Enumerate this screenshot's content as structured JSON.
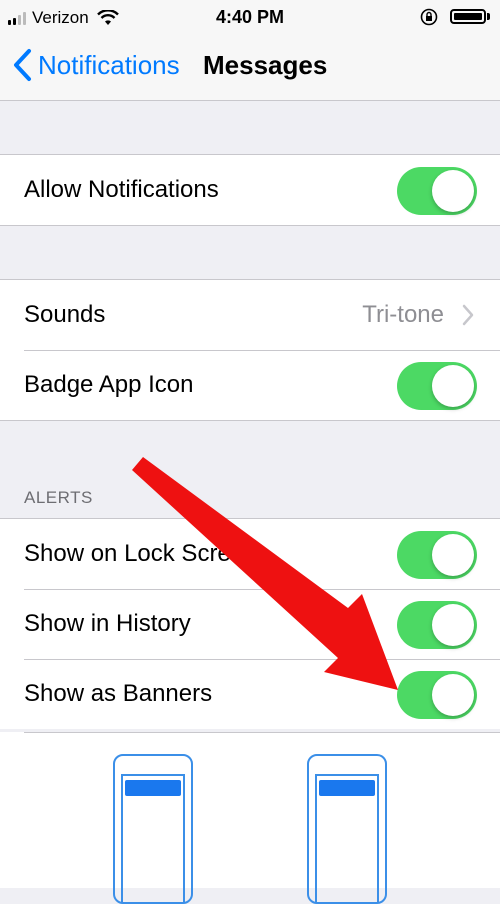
{
  "status_bar": {
    "carrier": "Verizon",
    "time": "4:40 PM",
    "battery_level": 1.0
  },
  "nav": {
    "back_label": "Notifications",
    "title": "Messages"
  },
  "groups": {
    "allow": {
      "label": "Allow Notifications",
      "on": true
    },
    "sounds": {
      "label": "Sounds",
      "value": "Tri-tone"
    },
    "badge": {
      "label": "Badge App Icon",
      "on": true
    }
  },
  "alerts": {
    "header": "ALERTS",
    "items": [
      {
        "label": "Show on Lock Screen",
        "on": true
      },
      {
        "label": "Show in History",
        "on": true
      },
      {
        "label": "Show as Banners",
        "on": true
      }
    ]
  },
  "colors": {
    "accent": "#007aff",
    "toggle_on": "#4cd964",
    "annotation_arrow": "#ee1111"
  }
}
